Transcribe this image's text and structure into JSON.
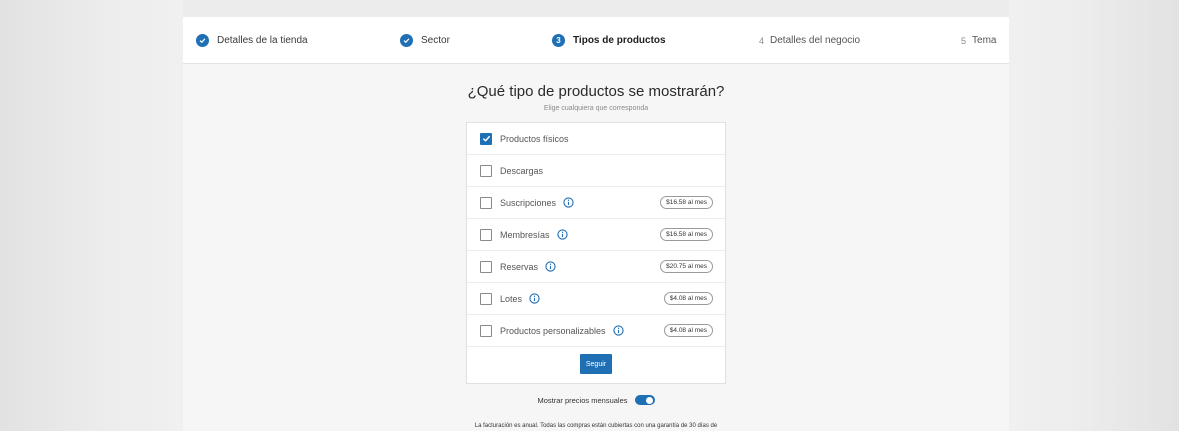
{
  "steps": [
    {
      "label": "Detalles de la tienda",
      "state": "done"
    },
    {
      "label": "Sector",
      "state": "done"
    },
    {
      "label": "Tipos de productos",
      "state": "active",
      "number": "3"
    },
    {
      "label": "Detalles del negocio",
      "state": "todo",
      "number": "4"
    },
    {
      "label": "Tema",
      "state": "todo",
      "number": "5"
    }
  ],
  "main": {
    "heading": "¿Qué tipo de productos se mostrarán?",
    "subheading": "Elige cualquiera que corresponda"
  },
  "options": [
    {
      "label": "Productos físicos",
      "checked": true,
      "info": false,
      "price": ""
    },
    {
      "label": "Descargas",
      "checked": false,
      "info": false,
      "price": ""
    },
    {
      "label": "Suscripciones",
      "checked": false,
      "info": true,
      "price": "$16.58 al mes"
    },
    {
      "label": "Membresías",
      "checked": false,
      "info": true,
      "price": "$16.58 al mes"
    },
    {
      "label": "Reservas",
      "checked": false,
      "info": true,
      "price": "$20.75 al mes"
    },
    {
      "label": "Lotes",
      "checked": false,
      "info": true,
      "price": "$4.08 al mes"
    },
    {
      "label": "Productos personalizables",
      "checked": false,
      "info": true,
      "price": "$4.08 al mes"
    }
  ],
  "continue_label": "Seguir",
  "toggle": {
    "label": "Mostrar precios mensuales",
    "on": true
  },
  "footnote": "La facturación es anual. Todas las compras están cubiertas con una garantía de 30 días de",
  "colors": {
    "accent": "#1f6fb5",
    "background": "#f6f6f6"
  }
}
